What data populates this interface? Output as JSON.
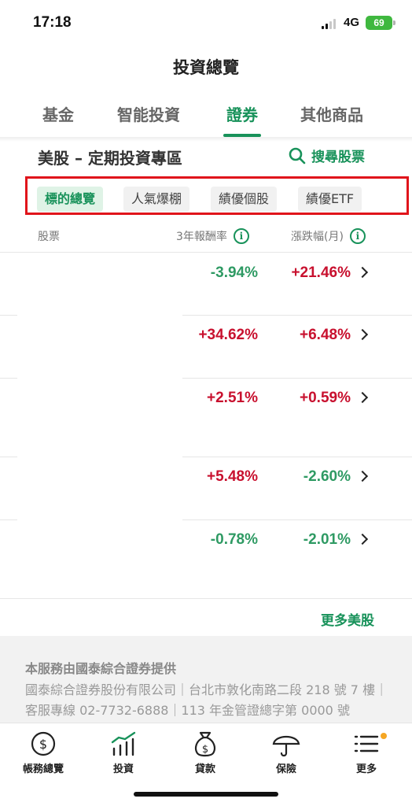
{
  "status_bar": {
    "time": "17:18",
    "network": "4G",
    "battery": "69"
  },
  "header": {
    "title": "投資總覽"
  },
  "tabs": [
    {
      "label": "基金"
    },
    {
      "label": "智能投資"
    },
    {
      "label": "證券"
    },
    {
      "label": "其他商品"
    }
  ],
  "active_tab": "證券",
  "section": {
    "title": "美股 – 定期投資專區",
    "search_label": "搜尋股票"
  },
  "chips": [
    {
      "label": "標的總覽"
    },
    {
      "label": "人氣爆棚"
    },
    {
      "label": "績優個股"
    },
    {
      "label": "績優ETF"
    }
  ],
  "table": {
    "headers": {
      "stock": "股票",
      "return_3y": "3年報酬率",
      "change_month": "漲跌幅(月)"
    },
    "info_glyph": "i",
    "rows": [
      {
        "return_3y": "-3.94%",
        "change_month": "+21.46%"
      },
      {
        "return_3y": "+34.62%",
        "change_month": "+6.48%"
      },
      {
        "return_3y": "+2.51%",
        "change_month": "+0.59%"
      },
      {
        "return_3y": "+5.48%",
        "change_month": "-2.60%"
      },
      {
        "return_3y": "-0.78%",
        "change_month": "-2.01%"
      }
    ]
  },
  "more_link": "更多美股",
  "disclaimer": {
    "title": "本服務由國泰綜合證券提供",
    "body": "國泰綜合證券股份有限公司｜台北市敦化南路二段 218 號 7 樓｜客服專線 02-7732-6888｜113 年金管證總字第 0000 號"
  },
  "bottom_nav": [
    {
      "label": "帳務總覽",
      "icon": "dollar-circle-icon"
    },
    {
      "label": "投資",
      "icon": "bar-chart-icon"
    },
    {
      "label": "貸款",
      "icon": "money-bag-icon"
    },
    {
      "label": "保險",
      "icon": "umbrella-icon"
    },
    {
      "label": "更多",
      "icon": "menu-icon"
    }
  ],
  "colors": {
    "accent": "#18925a",
    "up": "#c8102e",
    "down": "#2e9a63",
    "highlight_box": "#e0141b"
  }
}
